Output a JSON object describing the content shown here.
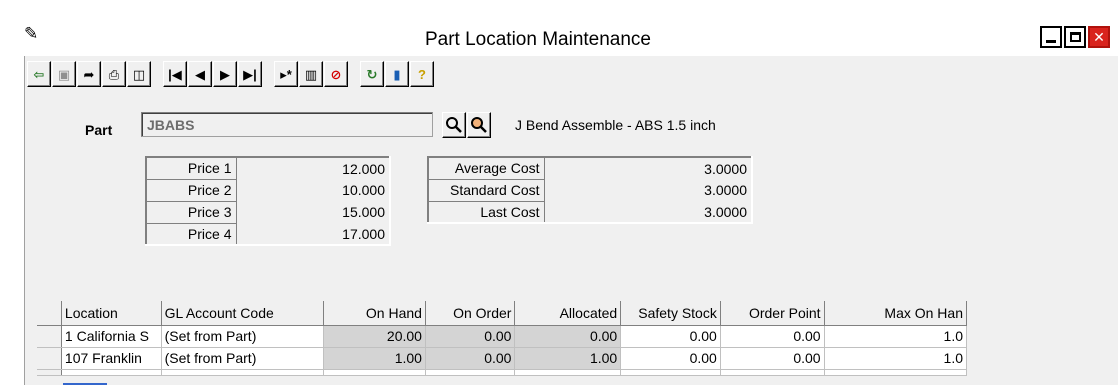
{
  "window": {
    "title": "Part Location Maintenance",
    "app_icon": "paint-brush-icon"
  },
  "toolbar": {
    "buttons": [
      {
        "name": "exit-icon",
        "glyph": "⇦"
      },
      {
        "name": "save-icon",
        "glyph": "▣"
      },
      {
        "name": "arrow-icon",
        "glyph": "➦"
      },
      {
        "name": "print-icon",
        "glyph": "⎙"
      },
      {
        "name": "print-preview-icon",
        "glyph": "🔍"
      },
      {
        "name": "first-record-icon",
        "glyph": "|◀"
      },
      {
        "name": "previous-record-icon",
        "glyph": "◀"
      },
      {
        "name": "next-record-icon",
        "glyph": "▶"
      },
      {
        "name": "last-record-icon",
        "glyph": "▶|"
      },
      {
        "name": "new-record-icon",
        "glyph": "▶*"
      },
      {
        "name": "delete-icon",
        "glyph": "🗑"
      },
      {
        "name": "cancel-icon",
        "glyph": "⊘"
      },
      {
        "name": "refresh-icon",
        "glyph": "↻"
      },
      {
        "name": "book-icon",
        "glyph": "📘"
      },
      {
        "name": "help-icon",
        "glyph": "?"
      }
    ]
  },
  "part": {
    "label": "Part",
    "value": "JBABS",
    "description": "J Bend Assemble - ABS 1.5 inch"
  },
  "prices": [
    {
      "label": "Price 1",
      "value": "12.000"
    },
    {
      "label": "Price 2",
      "value": "10.000"
    },
    {
      "label": "Price 3",
      "value": "15.000"
    },
    {
      "label": "Price 4",
      "value": "17.000"
    }
  ],
  "costs": [
    {
      "label": "Average Cost",
      "value": "3.0000"
    },
    {
      "label": "Standard Cost",
      "value": "3.0000"
    },
    {
      "label": "Last Cost",
      "value": "3.0000"
    }
  ],
  "grid": {
    "columns": [
      "Location",
      "GL Account Code",
      "On Hand",
      "On Order",
      "Allocated",
      "Safety Stock",
      "Order Point",
      "Max On Han"
    ],
    "rows": [
      [
        "1 California S",
        "(Set from Part)",
        "20.00",
        "0.00",
        "0.00",
        "0.00",
        "0.00",
        "1.0"
      ],
      [
        "107 Franklin",
        "(Set from Part)",
        "1.00",
        "0.00",
        "1.00",
        "0.00",
        "0.00",
        "1.0"
      ]
    ]
  }
}
